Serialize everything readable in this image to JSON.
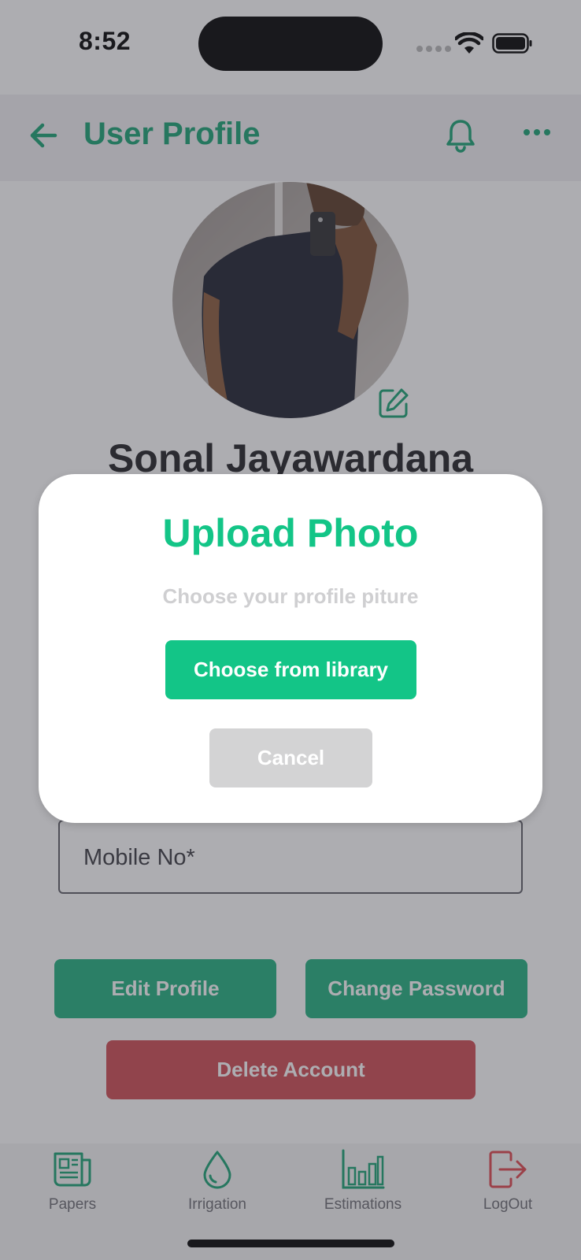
{
  "status_bar": {
    "time": "8:52"
  },
  "header": {
    "title": "User Profile"
  },
  "profile": {
    "name": "Sonal Jayawardana"
  },
  "form": {
    "mobile_placeholder": "Mobile No*"
  },
  "actions": {
    "edit_profile": "Edit Profile",
    "change_password": "Change Password",
    "delete_account": "Delete Account"
  },
  "bottom_nav": {
    "items": [
      {
        "label": "Papers",
        "icon": "newspaper-icon"
      },
      {
        "label": "Irrigation",
        "icon": "water-drop-icon"
      },
      {
        "label": "Estimations",
        "icon": "bar-chart-icon"
      },
      {
        "label": "LogOut",
        "icon": "logout-icon"
      }
    ]
  },
  "modal": {
    "title": "Upload Photo",
    "subtitle": "Choose your profile piture",
    "choose_label": "Choose from library",
    "cancel_label": "Cancel"
  },
  "colors": {
    "brand_green": "#13c587",
    "header_green": "#17a373",
    "danger_red": "#cf4b51",
    "logout_red": "#e0454d"
  }
}
